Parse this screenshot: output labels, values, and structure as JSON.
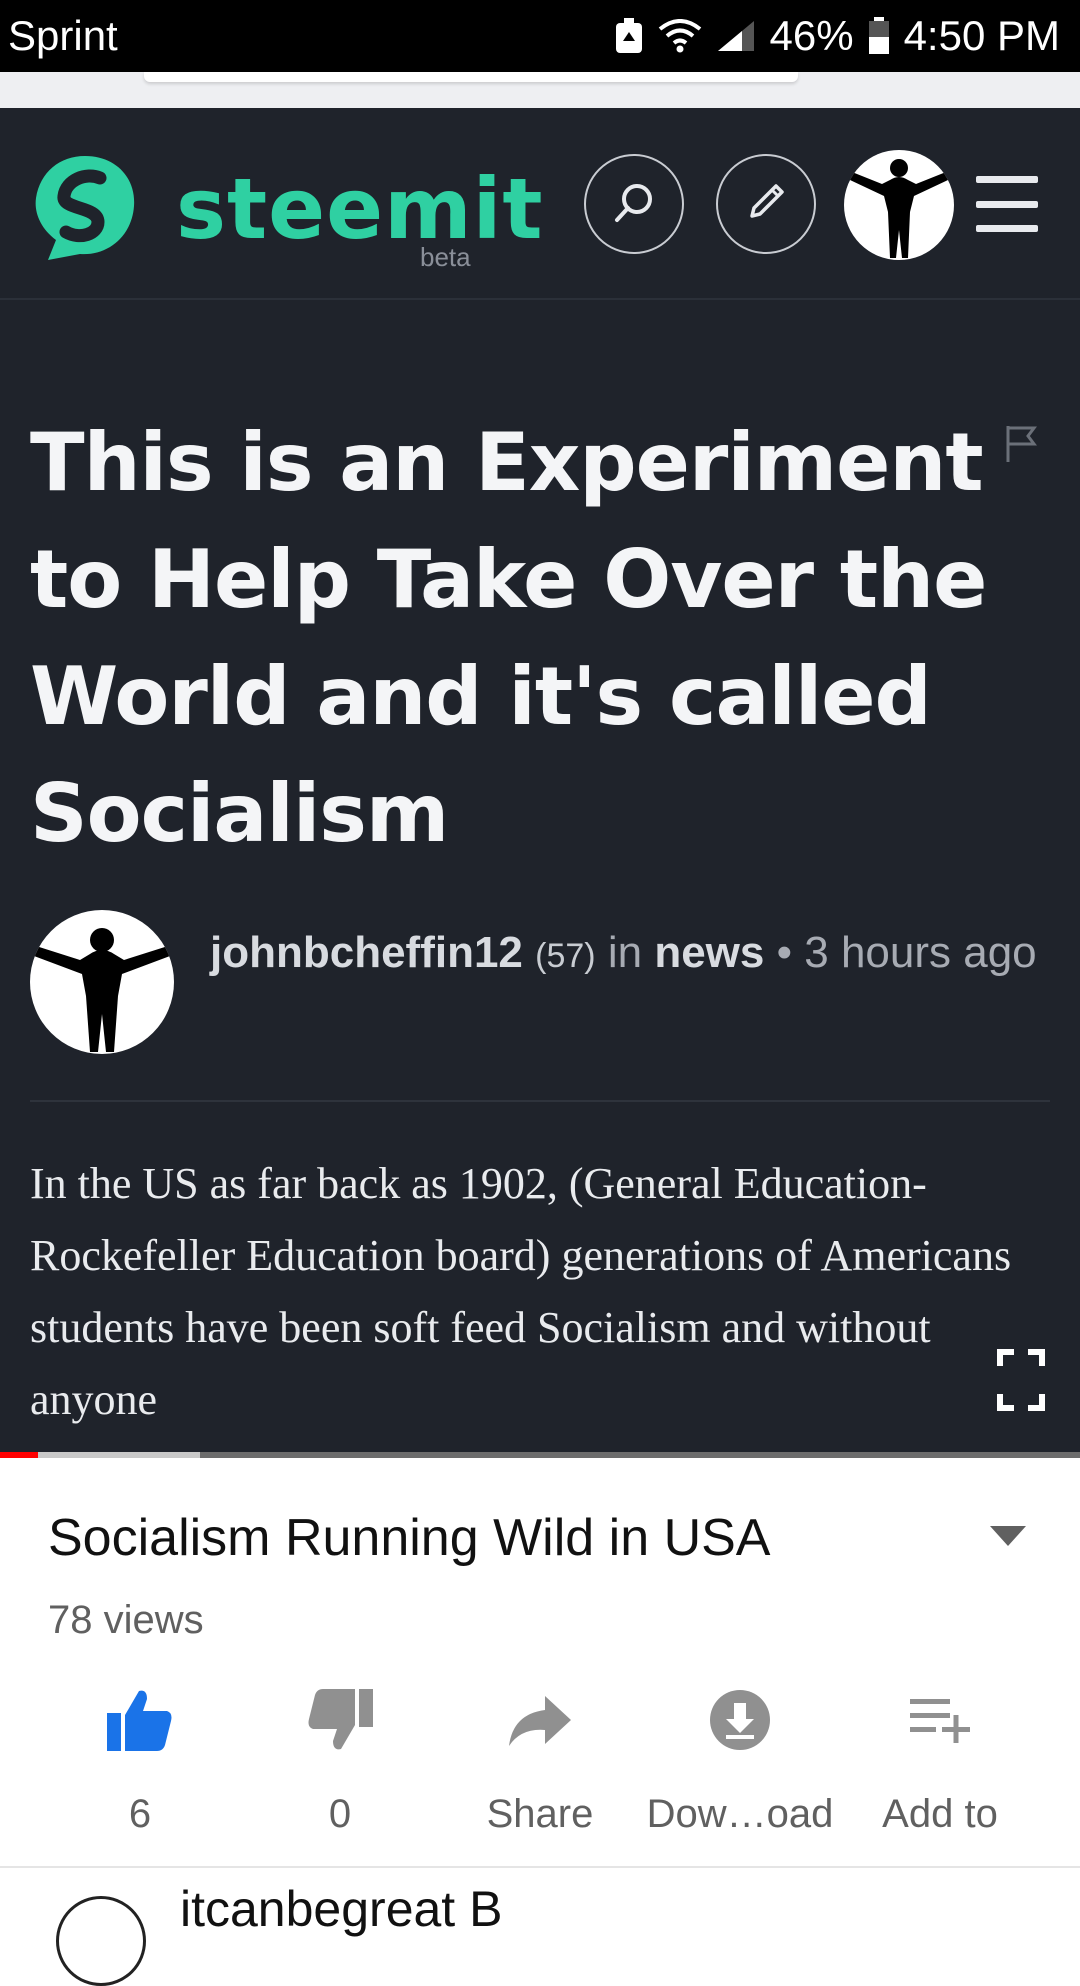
{
  "status_bar": {
    "carrier": "Sprint",
    "battery": "46%",
    "time": "4:50 PM"
  },
  "steemit": {
    "brand": "steemit",
    "badge": "beta",
    "brand_color": "#2fd0a2",
    "icons": [
      "search-icon",
      "pencil-icon",
      "avatar",
      "menu-icon",
      "flag-icon"
    ]
  },
  "post": {
    "title": "This is an Experiment to Help Take Over the World and it's called Socialism",
    "author": "johnbcheffin12",
    "reputation": "(57)",
    "in_word": "in",
    "category": "news",
    "bullet": "•",
    "time_ago": "3 hours ago",
    "body": "In the US as far back as 1902, (General Education-Rockefeller Education board) generations of Americans students have been soft feed Socialism and without anyone"
  },
  "player": {
    "progress_played": 0.035,
    "progress_buffered": 0.185,
    "played_color": "#ff0000"
  },
  "video": {
    "title": "Socialism Running Wild in USA",
    "views": "78 views",
    "actions": [
      {
        "label": "6",
        "icon": "thumbs-up-icon",
        "color": "#1a73e8"
      },
      {
        "label": "0",
        "icon": "thumbs-down-icon",
        "color": "#909090"
      },
      {
        "label": "Share",
        "icon": "share-icon",
        "color": "#909090"
      },
      {
        "label": "Dow…oad",
        "icon": "download-icon",
        "color": "#909090"
      },
      {
        "label": "Add to",
        "icon": "add-to-playlist-icon",
        "color": "#909090"
      }
    ]
  },
  "channel": {
    "name": "itcanbegreat B"
  }
}
